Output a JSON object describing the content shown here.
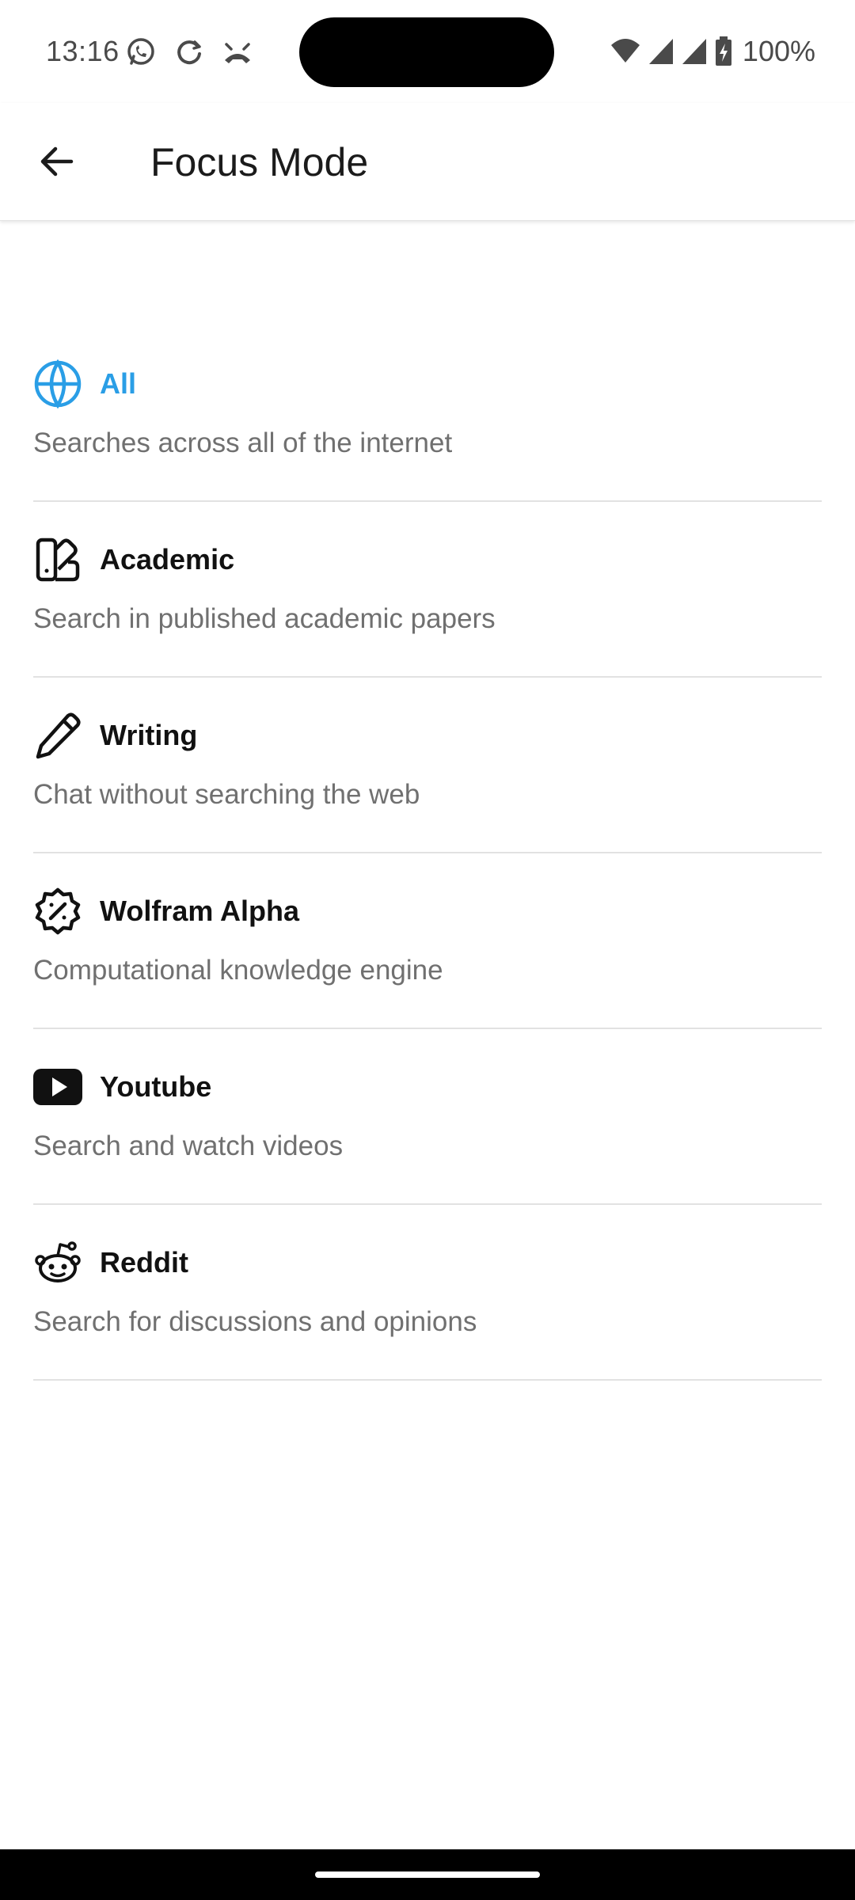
{
  "status_bar": {
    "time": "13:16",
    "battery": "100%",
    "icons": [
      "whatsapp-icon",
      "sync-icon",
      "call-muted-icon",
      "wifi-icon",
      "signal-icon",
      "signal-icon",
      "battery-charging-icon"
    ]
  },
  "header": {
    "back_icon": "arrow-left-icon",
    "title": "Focus Mode"
  },
  "accent_color": "#2a9ee6",
  "modes": [
    {
      "icon": "globe-icon",
      "title": "All",
      "description": "Searches across all of the internet",
      "selected": true
    },
    {
      "icon": "swatch-book-icon",
      "title": "Academic",
      "description": "Search in published academic papers",
      "selected": false
    },
    {
      "icon": "pencil-icon",
      "title": "Writing",
      "description": "Chat without searching the web",
      "selected": false
    },
    {
      "icon": "badge-percent-icon",
      "title": "Wolfram Alpha",
      "description": "Computational knowledge engine",
      "selected": false
    },
    {
      "icon": "youtube-icon",
      "title": "Youtube",
      "description": "Search and watch videos",
      "selected": false
    },
    {
      "icon": "reddit-icon",
      "title": "Reddit",
      "description": "Search for discussions and opinions",
      "selected": false
    }
  ]
}
